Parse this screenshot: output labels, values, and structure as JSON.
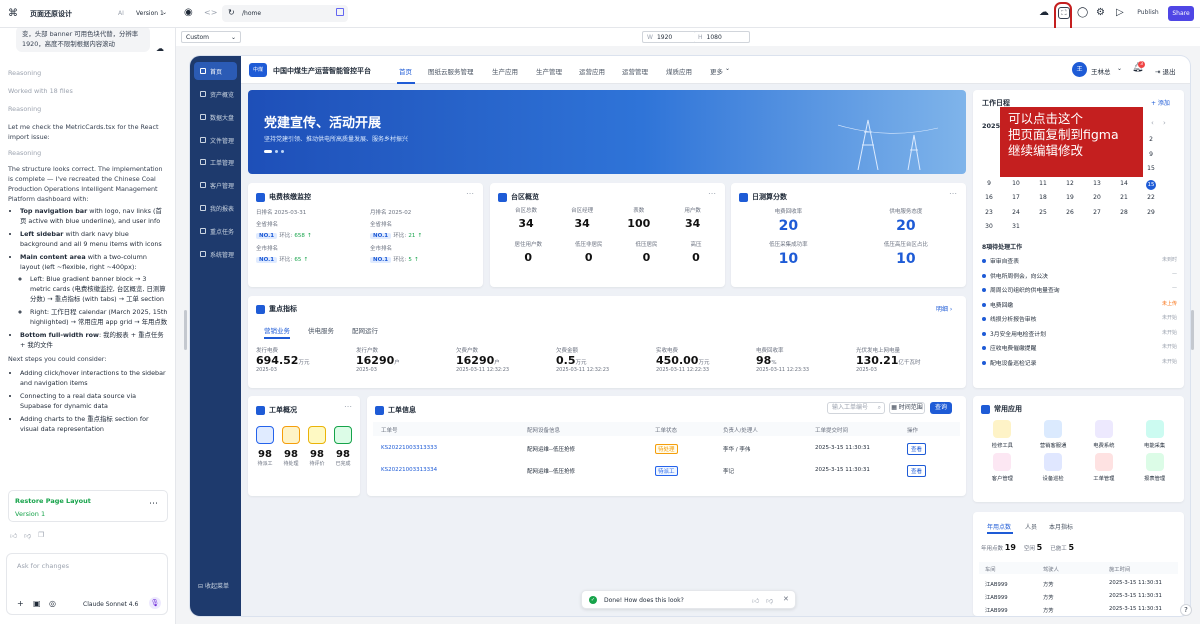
{
  "topbar": {
    "project": "页面还原设计",
    "version_label": "AI",
    "version": "Version 1",
    "url": "/home",
    "publish": "Publish",
    "share": "Share"
  },
  "canvas": {
    "device": "Custom",
    "w_label": "W",
    "width": "1920",
    "h_label": "H",
    "height": "1080"
  },
  "chat": {
    "intro": "变，头部 banner 可用色块代替，分辨率 1920，高度不限制根据内容滚动",
    "reasoning": "Reasoning",
    "worked": "Worked with 18 files",
    "check": "Let me check the MetricCards.tsx for the React import issue:",
    "summary": "The structure looks correct. The implementation is complete — I've recreated the Chinese Coal Production Operations Intelligent Management Platform dashboard with:",
    "bullets": [
      {
        "b": "Top navigation bar",
        "t": " with logo, nav links (首页 active with blue underline), and user info"
      },
      {
        "b": "Left sidebar",
        "t": " with dark navy blue background and all 9 menu items with icons"
      },
      {
        "b": "Main content area",
        "t": " with a two-column layout (left ~flexible, right ~400px):"
      }
    ],
    "sub": [
      "Left: Blue gradient banner block → 3 metric cards (电费核缴监控, 台区概览, 日测算分数) → 重点指标 (with tabs) → 工单 section",
      "Right: 工作日程 calendar (March 2025, 15th highlighted) → 常用应用 app grid → 年用点数"
    ],
    "bullet4": {
      "b": "Bottom full-width row",
      "t": ": 我的报表 + 重点任务 + 我的文件"
    },
    "next": "Next steps you could consider:",
    "next_items": [
      "Adding click/hover interactions to the sidebar and navigation items",
      "Connecting to a real data source via Supabase for dynamic data",
      "Adding charts to the 重点指标 section for visual data representation"
    ],
    "restore_title": "Restore Page Layout",
    "restore_ver": "Version 1",
    "placeholder": "Ask for changes",
    "model": "Claude Sonnet 4.6"
  },
  "app": {
    "logo": "中煤",
    "title": "中国中煤生产运营智能管控平台",
    "nav": [
      "首页",
      "图纸云服务管理",
      "生产应用",
      "生产管理",
      "运营应用",
      "运营管理",
      "煤质应用",
      "更多"
    ],
    "user_initial": "王",
    "user": "王林总",
    "notif": "3",
    "logout": "退出",
    "side": [
      "首页",
      "资产概览",
      "数据大盘",
      "文件管理",
      "工单管理",
      "客户管理",
      "我的报表",
      "重点任务",
      "系统管理"
    ],
    "collapse": "收起菜单",
    "banner_title": "党建宣传、活动开展",
    "banner_sub": "坚持党建引领、推动供电所高质量发展、服务乡村振兴",
    "c1": {
      "title": "电费核缴监控",
      "m1": "日排名",
      "d1": "2025-03-31",
      "m2": "月排名",
      "d2": "2025-02",
      "rank": "全省排名",
      "no": "NO.1",
      "cmp": "环比:",
      "v1": "658",
      "v2": "21",
      "r2": "全市排名",
      "v3": "65",
      "v4": "5"
    },
    "c2": {
      "title": "台区概览",
      "h": [
        "台区总数",
        "台区经理",
        "表数",
        "用户数"
      ],
      "v": [
        "34",
        "34",
        "100",
        "34"
      ],
      "h2": [
        "居住用户数",
        "低压非居民",
        "低压居民",
        "高压"
      ],
      "v2": [
        "0",
        "0",
        "0",
        "0"
      ]
    },
    "c3": {
      "title": "日测算分数",
      "a": "电费回收率",
      "av": "20",
      "b": "供电服务态度",
      "bv": "20",
      "c": "低压采集成功率",
      "cv": "10",
      "d": "低压高压台区占比",
      "dv": "10"
    },
    "kpi": {
      "title": "重点指标",
      "link": "明细",
      "tabs": [
        "营销业务",
        "供电服务",
        "配网运行"
      ],
      "items": [
        {
          "l": "发行电费",
          "v": "694.52",
          "u": "万元",
          "d": "2025-03"
        },
        {
          "l": "发行户数",
          "v": "16290",
          "u": "户",
          "d": "2025-03"
        },
        {
          "l": "欠费户数",
          "v": "16290",
          "u": "户",
          "d": "2025-03-11 12:32:23"
        },
        {
          "l": "欠费金额",
          "v": "0.5",
          "u": "万元",
          "d": "2025-03-11 12:32:23"
        },
        {
          "l": "实收电费",
          "v": "450.00",
          "u": "万元",
          "d": "2025-03-11 12:22:33"
        },
        {
          "l": "电费回收率",
          "v": "98",
          "u": "%",
          "d": "2025-03-11 12:23:33"
        },
        {
          "l": "光伏发电上网电量",
          "v": "130.21",
          "u": "亿千瓦时",
          "d": "2025-03"
        }
      ]
    },
    "wo": {
      "title": "工单概况",
      "items": [
        {
          "v": "98",
          "l": "待派工",
          "c": "#2563eb"
        },
        {
          "v": "98",
          "l": "待处理",
          "c": "#f59e0b"
        },
        {
          "v": "98",
          "l": "待评价",
          "c": "#eab308"
        },
        {
          "v": "98",
          "l": "已完成",
          "c": "#16a34a"
        }
      ]
    },
    "wi": {
      "title": "工单信息",
      "search": "输入工单编号",
      "time": "时间范围",
      "query": "查询",
      "cols": [
        "工单号",
        "配网设备信息",
        "工单状态",
        "负责人/处理人",
        "工单提交时间",
        "操作"
      ],
      "rows": [
        {
          "id": "KS20221003313333",
          "dev": "配网运维--低压抢修",
          "st": "待处理",
          "sc": "#f59e0b",
          "p": "李华 / 李伟",
          "t": "2025-3-15 11:30:31",
          "op": "查看"
        },
        {
          "id": "KS20221003313334",
          "dev": "配网运维--低压抢修",
          "st": "待派工",
          "sc": "#2563eb",
          "p": "李记",
          "t": "2025-3-15 11:30:31",
          "op": "查看"
        }
      ]
    },
    "sched": {
      "title": "工作日程",
      "add": "+ 添加",
      "month": "2025年",
      "weeks": [
        [
          "",
          "",
          "",
          "",
          "",
          "1",
          "2"
        ],
        [
          "",
          "",
          "",
          "",
          "",
          "",
          "9"
        ],
        [
          "",
          "",
          "",
          "",
          "",
          "",
          "15"
        ],
        [
          "9",
          "10",
          "11",
          "12",
          "13",
          "14",
          "15"
        ],
        [
          "16",
          "17",
          "18",
          "19",
          "20",
          "21",
          "22"
        ],
        [
          "23",
          "24",
          "25",
          "26",
          "27",
          "28",
          "29"
        ],
        [
          "30",
          "31",
          "",
          "",
          "",
          "",
          ""
        ]
      ],
      "todo_title": "8項待处理工作",
      "todos": [
        {
          "t": "审审自查表",
          "s": "未到时"
        },
        {
          "t": "供电所周例会，向公决",
          "s": "—"
        },
        {
          "t": "周周公司组织的供电量查询",
          "s": "—"
        },
        {
          "t": "电费回缴",
          "s": "未上传"
        },
        {
          "t": "线损分析报告审核",
          "s": "未开始"
        },
        {
          "t": "3月安全用电检查计划",
          "s": "未开始"
        },
        {
          "t": "应收电费催缴提醒",
          "s": "未开始"
        },
        {
          "t": "配电设备巡检记录",
          "s": "未开始"
        }
      ]
    },
    "apps": {
      "title": "常用应用",
      "items": [
        {
          "l": "检修工具",
          "c": "#f59e0b"
        },
        {
          "l": "营销客服通",
          "c": "#3b82f6"
        },
        {
          "l": "电费系统",
          "c": "#8b5cf6"
        },
        {
          "l": "电能采集",
          "c": "#14b8a6"
        },
        {
          "l": "客户管理",
          "c": "#ec4899"
        },
        {
          "l": "设备巡检",
          "c": "#6366f1"
        },
        {
          "l": "工单管理",
          "c": "#ef4444"
        },
        {
          "l": "报表管理",
          "c": "#22c55e"
        }
      ]
    },
    "yr": {
      "tabs": [
        "年用点数",
        "人员",
        "本月指标"
      ],
      "a": "年用点数",
      "av": "19",
      "b": "空闲",
      "bv": "5",
      "c": "已施工",
      "cv": "5",
      "cols": [
        "车间",
        "驾驶人",
        "施工时间"
      ],
      "rows": [
        {
          "a": "江AB999",
          "b": "方芳",
          "c": "2025-3-15 11:30:31"
        },
        {
          "a": "江AB999",
          "b": "方芳",
          "c": "2025-3-15 11:30:31"
        },
        {
          "a": "江AB999",
          "b": "方芳",
          "c": "2025-3-15 11:30:31"
        }
      ]
    }
  },
  "toast": "Done! How does this look?",
  "annotation": [
    "可以点击这个",
    "把页面复制到figma",
    "继续编辑修改"
  ],
  "help": "?"
}
